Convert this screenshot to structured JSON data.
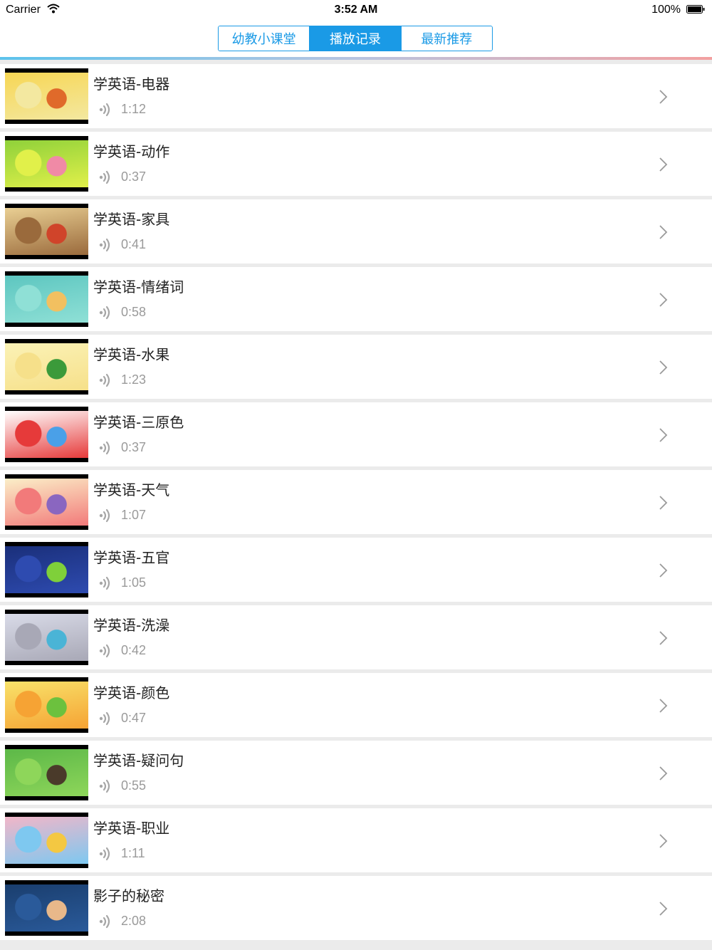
{
  "status_bar": {
    "carrier": "Carrier",
    "time": "3:52 AM",
    "battery": "100%"
  },
  "tabs": [
    {
      "label": "幼教小课堂",
      "active": false
    },
    {
      "label": "播放记录",
      "active": true
    },
    {
      "label": "最新推荐",
      "active": false
    }
  ],
  "colors": {
    "accent": "#1a9ae6",
    "duration_text": "#9a9a9a"
  },
  "items": [
    {
      "title": "学英语-电器",
      "duration": "1:12",
      "thumb": [
        "#f7d654",
        "#f3e8a0",
        "#e06a2a"
      ]
    },
    {
      "title": "学英语-动作",
      "duration": "0:37",
      "thumb": [
        "#8fd13a",
        "#e1f04a",
        "#f08aa6"
      ]
    },
    {
      "title": "学英语-家具",
      "duration": "0:41",
      "thumb": [
        "#e9cf93",
        "#9a6a3c",
        "#d0442a"
      ]
    },
    {
      "title": "学英语-情绪词",
      "duration": "0:58",
      "thumb": [
        "#5dc6c0",
        "#8fe0d6",
        "#f2c060"
      ]
    },
    {
      "title": "学英语-水果",
      "duration": "1:23",
      "thumb": [
        "#fbf2b6",
        "#f6e08a",
        "#3b9a3a"
      ]
    },
    {
      "title": "学英语-三原色",
      "duration": "0:37",
      "thumb": [
        "#ffffff",
        "#e63a3a",
        "#4aa0e8"
      ]
    },
    {
      "title": "学英语-天气",
      "duration": "1:07",
      "thumb": [
        "#fbefc8",
        "#f27a7a",
        "#8a66c0"
      ]
    },
    {
      "title": "学英语-五官",
      "duration": "1:05",
      "thumb": [
        "#1a2f7a",
        "#2e4bb0",
        "#7fd03a"
      ]
    },
    {
      "title": "学英语-洗澡",
      "duration": "0:42",
      "thumb": [
        "#d9dbe8",
        "#a8a8b6",
        "#4ab4d6"
      ]
    },
    {
      "title": "学英语-颜色",
      "duration": "0:47",
      "thumb": [
        "#f8e26a",
        "#f6a334",
        "#6cc13e"
      ]
    },
    {
      "title": "学英语-疑问句",
      "duration": "0:55",
      "thumb": [
        "#5cb848",
        "#8ed65a",
        "#4a3a2a"
      ]
    },
    {
      "title": "学英语-职业",
      "duration": "1:11",
      "thumb": [
        "#f2b6c8",
        "#7ec8f0",
        "#f4c842"
      ]
    },
    {
      "title": "影子的秘密",
      "duration": "2:08",
      "thumb": [
        "#1a3e6e",
        "#2a5a9a",
        "#e8b88a"
      ]
    }
  ]
}
